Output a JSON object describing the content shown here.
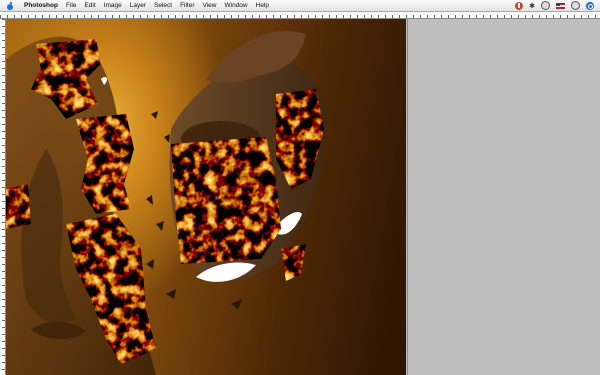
{
  "menubar": {
    "app_name": "Photoshop",
    "menus": [
      "File",
      "Edit",
      "Image",
      "Layer",
      "Select",
      "Filter",
      "View",
      "Window",
      "Help"
    ],
    "right_icons": [
      "app-status-icon",
      "bluetooth-icon",
      "volume-icon",
      "flag-icon",
      "time-machine-icon",
      "spotlight-icon"
    ]
  },
  "colors": {
    "canvas_gold": "#f0b43a",
    "canvas_brown": "#7e4a0d",
    "canvas_dark": "#2a1402",
    "pasteboard": "#bebebe",
    "ember_orange": "#e86a10",
    "ember_yellow": "#ffd24a"
  }
}
